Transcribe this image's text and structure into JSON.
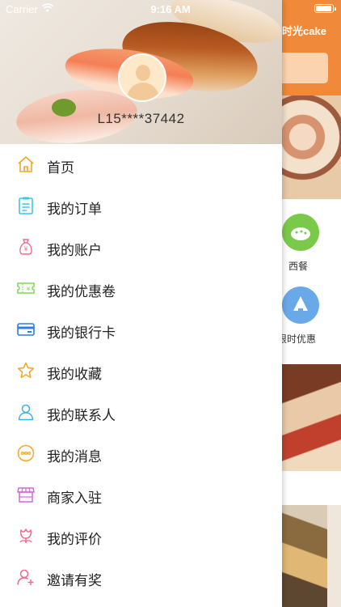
{
  "status_bar": {
    "carrier": "Carrier",
    "time": "9:16 AM"
  },
  "background_app": {
    "title_fragment": "时光cake",
    "categories": [
      "西餐",
      "限时优惠"
    ]
  },
  "drawer": {
    "username": "L15****37442",
    "menu": [
      {
        "label": "首页",
        "icon": "home-icon",
        "color": "#f5a623"
      },
      {
        "label": "我的订单",
        "icon": "order-list-icon",
        "color": "#3cc6e8"
      },
      {
        "label": "我的账户",
        "icon": "money-bag-icon",
        "color": "#f06a8a"
      },
      {
        "label": "我的优惠卷",
        "icon": "ticket-icon",
        "color": "#7ed957"
      },
      {
        "label": "我的银行卡",
        "icon": "bank-card-icon",
        "color": "#2f7de1"
      },
      {
        "label": "我的收藏",
        "icon": "star-icon",
        "color": "#f5a623"
      },
      {
        "label": "我的联系人",
        "icon": "contact-icon",
        "color": "#3cb1e8"
      },
      {
        "label": "我的消息",
        "icon": "message-icon",
        "color": "#f5a623"
      },
      {
        "label": "商家入驻",
        "icon": "shop-icon",
        "color": "#d06ad4"
      },
      {
        "label": "我的评价",
        "icon": "flower-icon",
        "color": "#f06a8a"
      },
      {
        "label": "邀请有奖",
        "icon": "invite-user-icon",
        "color": "#f06a8a"
      }
    ]
  }
}
